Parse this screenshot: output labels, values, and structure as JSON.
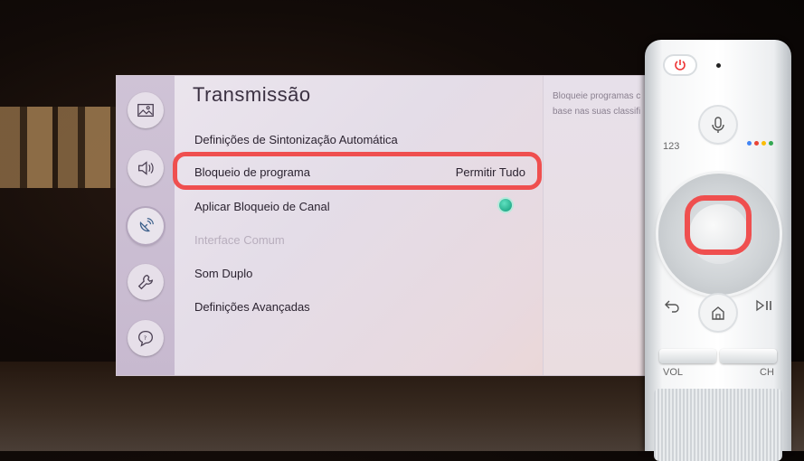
{
  "screen": {
    "title": "Transmissão",
    "sidebar": [
      {
        "name": "picture-icon"
      },
      {
        "name": "sound-icon"
      },
      {
        "name": "broadcast-icon",
        "active": true
      },
      {
        "name": "wrench-icon"
      },
      {
        "name": "support-icon"
      }
    ],
    "menu": {
      "items": [
        {
          "label": "Definições de Sintonização Automática",
          "value": "",
          "disabled": false
        },
        {
          "label": "Bloqueio de programa",
          "value": "Permitir Tudo",
          "disabled": false,
          "highlighted": true
        },
        {
          "label": "Aplicar Bloqueio de Canal",
          "value": "",
          "toggle": "on",
          "disabled": false
        },
        {
          "label": "Interface Comum",
          "value": "",
          "disabled": true
        },
        {
          "label": "Som Duplo",
          "value": "",
          "disabled": false
        },
        {
          "label": "Definições Avançadas",
          "value": "",
          "disabled": false
        }
      ]
    },
    "info_panel": {
      "line1": "Bloqueie programas c",
      "line2": "base nas suas classifi"
    }
  },
  "remote": {
    "label_123": "123",
    "vol_label": "VOL",
    "ch_label": "CH",
    "assistant_colors": [
      "#4285f4",
      "#ea4335",
      "#fbbc05",
      "#34a853"
    ]
  },
  "colors": {
    "highlight": "#ef4f4f",
    "toggle_on": "#0f9b78"
  }
}
